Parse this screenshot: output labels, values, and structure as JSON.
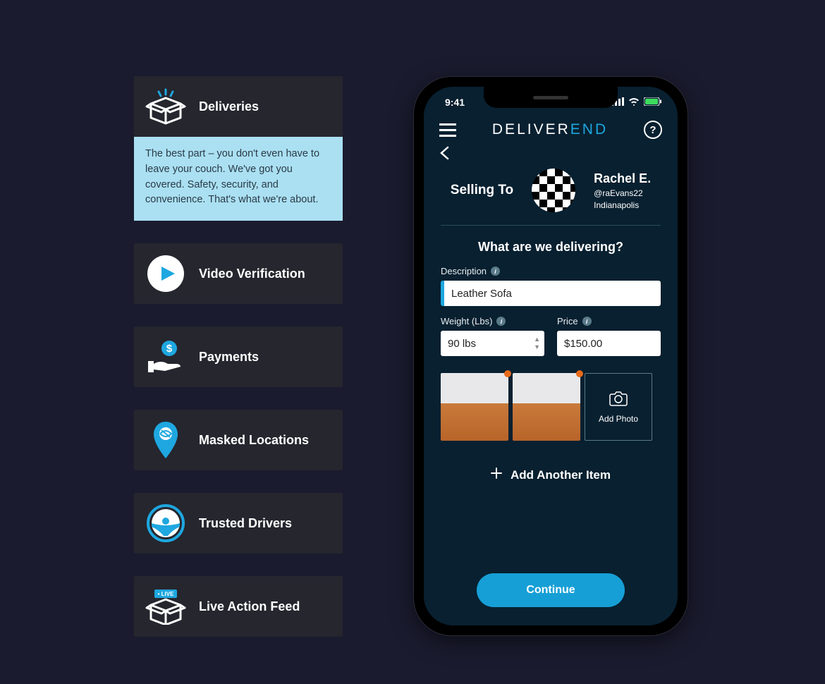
{
  "features": [
    {
      "label": "Deliveries",
      "description": "The best part – you don't even have to leave your couch. We've got you covered. Safety, security, and convenience. That's what we're about."
    },
    {
      "label": "Video Verification"
    },
    {
      "label": "Payments"
    },
    {
      "label": "Masked Locations"
    },
    {
      "label": "Trusted Drivers"
    },
    {
      "label": "Live Action Feed"
    }
  ],
  "phone": {
    "status_time": "9:41",
    "brand_part1": "DELIVER",
    "brand_part2": "END",
    "selling_to_label": "Selling To",
    "buyer": {
      "name": "Rachel E.",
      "handle": "@raEvans22",
      "city": "Indianapolis"
    },
    "section_title": "What are we delivering?",
    "description_label": "Description",
    "description_value": "Leather Sofa",
    "weight_label": "Weight (Lbs)",
    "weight_value": "90 lbs",
    "price_label": "Price",
    "price_value": "$150.00",
    "add_photo_label": "Add Photo",
    "add_another_label": "Add Another Item",
    "continue_label": "Continue"
  }
}
